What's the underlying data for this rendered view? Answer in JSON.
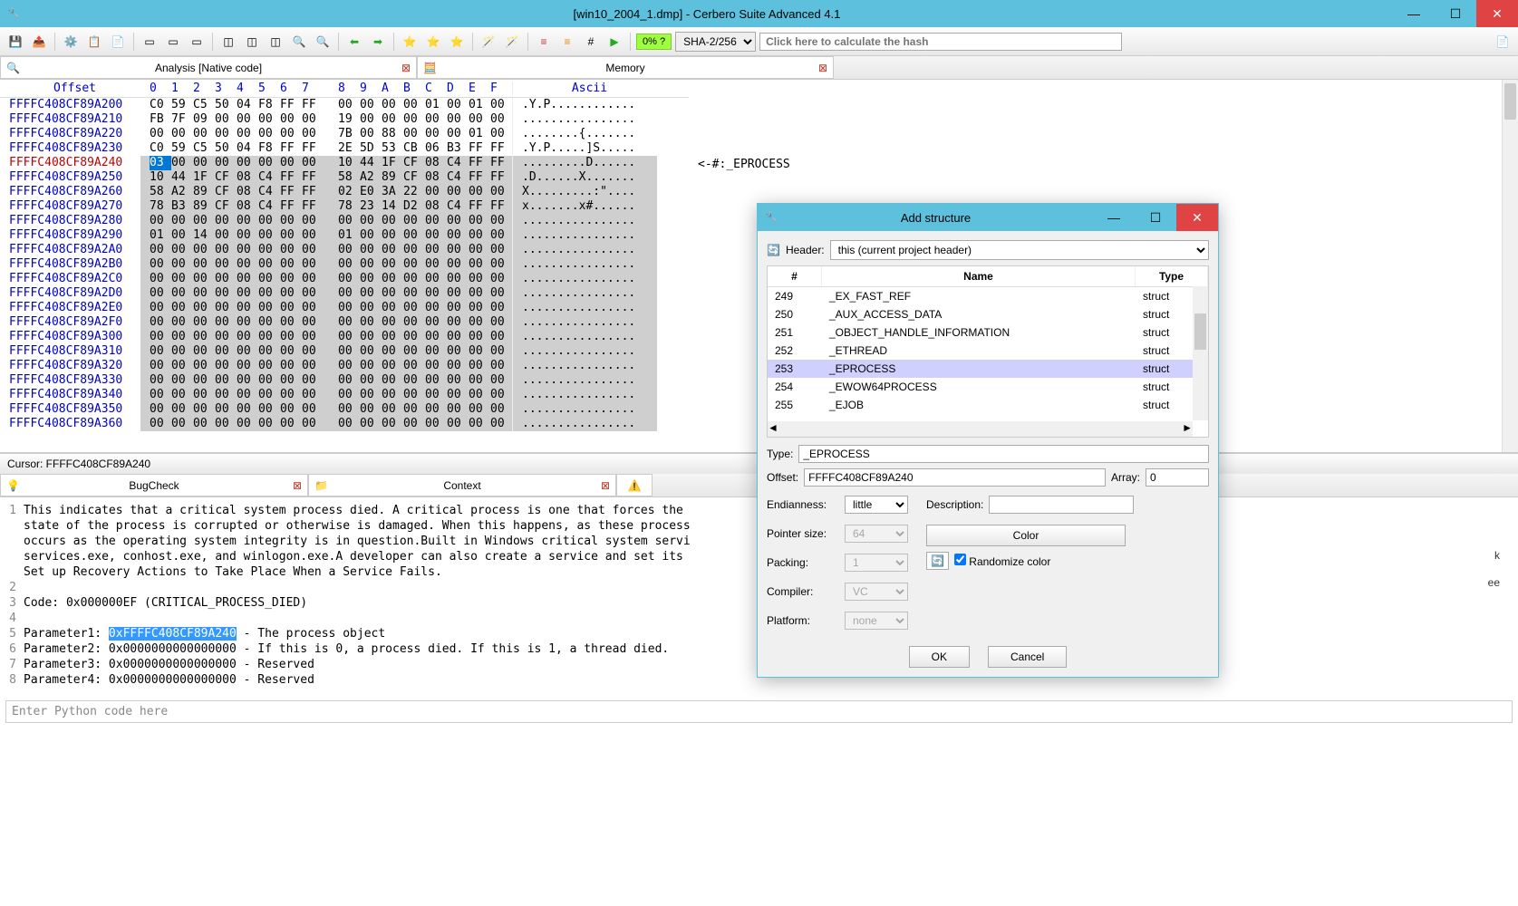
{
  "window": {
    "title": "[win10_2004_1.dmp] - Cerbero Suite Advanced 4.1"
  },
  "toolbar": {
    "pct": "0% ?",
    "hash_algo": "SHA-2/256",
    "hash_placeholder": "Click here to calculate the hash"
  },
  "tabs": {
    "analysis": "Analysis [Native code]",
    "memory": "Memory"
  },
  "hex": {
    "header_offset": "Offset",
    "header_ascii": "Ascii",
    "cols": [
      "0",
      "1",
      "2",
      "3",
      "4",
      "5",
      "6",
      "7",
      "8",
      "9",
      "A",
      "B",
      "C",
      "D",
      "E",
      "F"
    ],
    "rows": [
      {
        "off": "FFFFC408CF89A200",
        "b": [
          "C0",
          "59",
          "C5",
          "50",
          "04",
          "F8",
          "FF",
          "FF",
          "00",
          "00",
          "00",
          "00",
          "01",
          "00",
          "01",
          "00"
        ],
        "a": ".Y.P............"
      },
      {
        "off": "FFFFC408CF89A210",
        "b": [
          "FB",
          "7F",
          "09",
          "00",
          "00",
          "00",
          "00",
          "00",
          "19",
          "00",
          "00",
          "00",
          "00",
          "00",
          "00",
          "00"
        ],
        "a": "................"
      },
      {
        "off": "FFFFC408CF89A220",
        "b": [
          "00",
          "00",
          "00",
          "00",
          "00",
          "00",
          "00",
          "00",
          "7B",
          "00",
          "88",
          "00",
          "00",
          "00",
          "01",
          "00"
        ],
        "a": "........{......."
      },
      {
        "off": "FFFFC408CF89A230",
        "b": [
          "C0",
          "59",
          "C5",
          "50",
          "04",
          "F8",
          "FF",
          "FF",
          "2E",
          "5D",
          "53",
          "CB",
          "06",
          "B3",
          "FF",
          "FF"
        ],
        "a": ".Y.P.....]S....."
      },
      {
        "off": "FFFFC408CF89A240",
        "b": [
          "03",
          "00",
          "00",
          "00",
          "00",
          "00",
          "00",
          "00",
          "10",
          "44",
          "1F",
          "CF",
          "08",
          "C4",
          "FF",
          "FF"
        ],
        "a": ".........D......",
        "hl": true,
        "red": true,
        "annot": "<-#:_EPROCESS",
        "cursor0": true
      },
      {
        "off": "FFFFC408CF89A250",
        "b": [
          "10",
          "44",
          "1F",
          "CF",
          "08",
          "C4",
          "FF",
          "FF",
          "58",
          "A2",
          "89",
          "CF",
          "08",
          "C4",
          "FF",
          "FF"
        ],
        "a": ".D......X.......",
        "hl": true
      },
      {
        "off": "FFFFC408CF89A260",
        "b": [
          "58",
          "A2",
          "89",
          "CF",
          "08",
          "C4",
          "FF",
          "FF",
          "02",
          "E0",
          "3A",
          "22",
          "00",
          "00",
          "00",
          "00"
        ],
        "a": "X.........:\"....",
        "hl": true
      },
      {
        "off": "FFFFC408CF89A270",
        "b": [
          "78",
          "B3",
          "89",
          "CF",
          "08",
          "C4",
          "FF",
          "FF",
          "78",
          "23",
          "14",
          "D2",
          "08",
          "C4",
          "FF",
          "FF"
        ],
        "a": "x.......x#......",
        "hl": true
      },
      {
        "off": "FFFFC408CF89A280",
        "b": [
          "00",
          "00",
          "00",
          "00",
          "00",
          "00",
          "00",
          "00",
          "00",
          "00",
          "00",
          "00",
          "00",
          "00",
          "00",
          "00"
        ],
        "a": "................",
        "hl": true
      },
      {
        "off": "FFFFC408CF89A290",
        "b": [
          "01",
          "00",
          "14",
          "00",
          "00",
          "00",
          "00",
          "00",
          "01",
          "00",
          "00",
          "00",
          "00",
          "00",
          "00",
          "00"
        ],
        "a": "................",
        "hl": true
      },
      {
        "off": "FFFFC408CF89A2A0",
        "b": [
          "00",
          "00",
          "00",
          "00",
          "00",
          "00",
          "00",
          "00",
          "00",
          "00",
          "00",
          "00",
          "00",
          "00",
          "00",
          "00"
        ],
        "a": "................",
        "hl": true
      },
      {
        "off": "FFFFC408CF89A2B0",
        "b": [
          "00",
          "00",
          "00",
          "00",
          "00",
          "00",
          "00",
          "00",
          "00",
          "00",
          "00",
          "00",
          "00",
          "00",
          "00",
          "00"
        ],
        "a": "................",
        "hl": true
      },
      {
        "off": "FFFFC408CF89A2C0",
        "b": [
          "00",
          "00",
          "00",
          "00",
          "00",
          "00",
          "00",
          "00",
          "00",
          "00",
          "00",
          "00",
          "00",
          "00",
          "00",
          "00"
        ],
        "a": "................",
        "hl": true
      },
      {
        "off": "FFFFC408CF89A2D0",
        "b": [
          "00",
          "00",
          "00",
          "00",
          "00",
          "00",
          "00",
          "00",
          "00",
          "00",
          "00",
          "00",
          "00",
          "00",
          "00",
          "00"
        ],
        "a": "................",
        "hl": true
      },
      {
        "off": "FFFFC408CF89A2E0",
        "b": [
          "00",
          "00",
          "00",
          "00",
          "00",
          "00",
          "00",
          "00",
          "00",
          "00",
          "00",
          "00",
          "00",
          "00",
          "00",
          "00"
        ],
        "a": "................",
        "hl": true
      },
      {
        "off": "FFFFC408CF89A2F0",
        "b": [
          "00",
          "00",
          "00",
          "00",
          "00",
          "00",
          "00",
          "00",
          "00",
          "00",
          "00",
          "00",
          "00",
          "00",
          "00",
          "00"
        ],
        "a": "................",
        "hl": true
      },
      {
        "off": "FFFFC408CF89A300",
        "b": [
          "00",
          "00",
          "00",
          "00",
          "00",
          "00",
          "00",
          "00",
          "00",
          "00",
          "00",
          "00",
          "00",
          "00",
          "00",
          "00"
        ],
        "a": "................",
        "hl": true
      },
      {
        "off": "FFFFC408CF89A310",
        "b": [
          "00",
          "00",
          "00",
          "00",
          "00",
          "00",
          "00",
          "00",
          "00",
          "00",
          "00",
          "00",
          "00",
          "00",
          "00",
          "00"
        ],
        "a": "................",
        "hl": true
      },
      {
        "off": "FFFFC408CF89A320",
        "b": [
          "00",
          "00",
          "00",
          "00",
          "00",
          "00",
          "00",
          "00",
          "00",
          "00",
          "00",
          "00",
          "00",
          "00",
          "00",
          "00"
        ],
        "a": "................",
        "hl": true
      },
      {
        "off": "FFFFC408CF89A330",
        "b": [
          "00",
          "00",
          "00",
          "00",
          "00",
          "00",
          "00",
          "00",
          "00",
          "00",
          "00",
          "00",
          "00",
          "00",
          "00",
          "00"
        ],
        "a": "................",
        "hl": true
      },
      {
        "off": "FFFFC408CF89A340",
        "b": [
          "00",
          "00",
          "00",
          "00",
          "00",
          "00",
          "00",
          "00",
          "00",
          "00",
          "00",
          "00",
          "00",
          "00",
          "00",
          "00"
        ],
        "a": "................",
        "hl": true
      },
      {
        "off": "FFFFC408CF89A350",
        "b": [
          "00",
          "00",
          "00",
          "00",
          "00",
          "00",
          "00",
          "00",
          "00",
          "00",
          "00",
          "00",
          "00",
          "00",
          "00",
          "00"
        ],
        "a": "................",
        "hl": true
      },
      {
        "off": "FFFFC408CF89A360",
        "b": [
          "00",
          "00",
          "00",
          "00",
          "00",
          "00",
          "00",
          "00",
          "00",
          "00",
          "00",
          "00",
          "00",
          "00",
          "00",
          "00"
        ],
        "a": "................",
        "hl": true
      }
    ],
    "cursor": "Cursor: FFFFC408CF89A240"
  },
  "lower_tabs": {
    "bugcheck": "BugCheck",
    "context": "Context"
  },
  "bugcheck": {
    "lines": [
      {
        "n": "1",
        "t": "This indicates that a critical system process died. A critical process is one that forces the"
      },
      {
        "n": "",
        "t": "state of the process is corrupted or otherwise is damaged. When this happens, as these process"
      },
      {
        "n": "",
        "t": "occurs as the operating system integrity is in question.Built in Windows critical system servi"
      },
      {
        "n": "",
        "t": "services.exe, conhost.exe, and winlogon.exe.A developer can also create a service and set its "
      },
      {
        "n": "",
        "t": "Set up Recovery Actions to Take Place When a Service Fails."
      },
      {
        "n": "2",
        "t": ""
      },
      {
        "n": "3",
        "t": "Code: 0x000000EF (CRITICAL_PROCESS_DIED)"
      },
      {
        "n": "4",
        "t": ""
      },
      {
        "n": "5",
        "t": "Parameter1: ",
        "hl": "0xFFFFC408CF89A240",
        "rest": " - The process object"
      },
      {
        "n": "6",
        "t": "Parameter2: 0x0000000000000000 - If this is 0, a process died. If this is 1, a thread died."
      },
      {
        "n": "7",
        "t": "Parameter3: 0x0000000000000000 - Reserved"
      },
      {
        "n": "8",
        "t": "Parameter4: 0x0000000000000000 - Reserved"
      }
    ]
  },
  "python": {
    "placeholder": "Enter Python code here"
  },
  "dialog": {
    "title": "Add structure",
    "header_label": "Header:",
    "header_value": "this (current project header)",
    "th_num": "#",
    "th_name": "Name",
    "th_type": "Type",
    "rows": [
      {
        "n": "249",
        "name": "_EX_FAST_REF",
        "type": "struct"
      },
      {
        "n": "250",
        "name": "_AUX_ACCESS_DATA",
        "type": "struct"
      },
      {
        "n": "251",
        "name": "_OBJECT_HANDLE_INFORMATION",
        "type": "struct"
      },
      {
        "n": "252",
        "name": "_ETHREAD",
        "type": "struct"
      },
      {
        "n": "253",
        "name": "_EPROCESS",
        "type": "struct",
        "sel": true
      },
      {
        "n": "254",
        "name": "_EWOW64PROCESS",
        "type": "struct"
      },
      {
        "n": "255",
        "name": "_EJOB",
        "type": "struct"
      }
    ],
    "type_label": "Type:",
    "type_value": "_EPROCESS",
    "offset_label": "Offset:",
    "offset_value": "FFFFC408CF89A240",
    "array_label": "Array:",
    "array_value": "0",
    "endianness_label": "Endianness:",
    "endianness_value": "little",
    "pointer_label": "Pointer size:",
    "pointer_value": "64",
    "packing_label": "Packing:",
    "packing_value": "1",
    "compiler_label": "Compiler:",
    "compiler_value": "VC",
    "platform_label": "Platform:",
    "platform_value": "none",
    "desc_label": "Description:",
    "color_btn": "Color",
    "randomize": "Randomize color",
    "ok": "OK",
    "cancel": "Cancel"
  },
  "right_hints": {
    "k": "k",
    "ee": "ee"
  }
}
